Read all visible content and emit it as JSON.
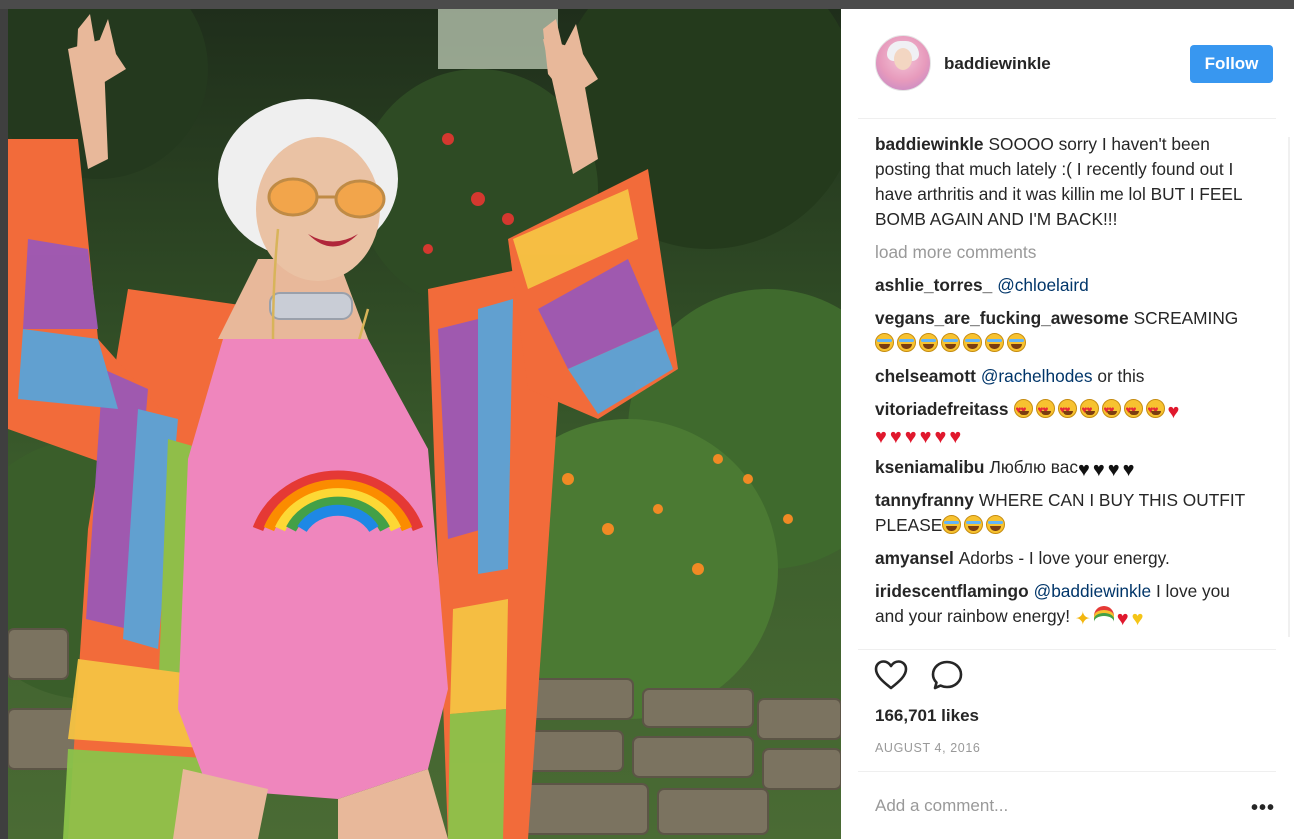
{
  "post": {
    "image_alt": "Woman in rainbow crochet cardigan and pink swimsuit with rainbow print, giving peace signs in a garden",
    "colors": {
      "swimsuit": "#ef86bd",
      "cardigan_orange": "#f26b3a",
      "cardigan_blue": "#5aa3d9",
      "cardigan_purple": "#9b59b6",
      "cardigan_green": "#8bc34a",
      "cardigan_yellow": "#f6c343",
      "foliage": "#2f4a25"
    }
  },
  "header": {
    "username": "baddiewinkle",
    "follow_label": "Follow",
    "follow_color": "#3897f0"
  },
  "caption": {
    "user": "baddiewinkle",
    "text": "SOOOO sorry I haven't been posting that much lately :( I recently found out I have arthritis and it was killin me lol BUT I FEEL BOMB AGAIN AND I'M BACK!!!"
  },
  "load_more": "load more comments",
  "comments": [
    {
      "user": "ashlie_torres_",
      "mention": "@chloelaird",
      "text": ""
    },
    {
      "user": "vegans_are_fucking_awesome",
      "text": "SCREAMING",
      "emojis": [
        "crying-face",
        "crying-face",
        "crying-face",
        "crying-face",
        "crying-face",
        "crying-face",
        "crying-face"
      ]
    },
    {
      "user": "chelseamott",
      "mention": "@rachelhodes",
      "text": "or this"
    },
    {
      "user": "vitoriadefreitass",
      "text": "",
      "emojis": [
        "heart-eyes-face",
        "heart-eyes-face",
        "heart-eyes-face",
        "heart-eyes-face",
        "heart-eyes-face",
        "heart-eyes-face",
        "heart-eyes-face",
        "red-heart",
        "red-heart",
        "red-heart",
        "red-heart",
        "red-heart",
        "red-heart",
        "red-heart"
      ]
    },
    {
      "user": "kseniamalibu",
      "text": "Люблю вас",
      "emojis": [
        "black-heart",
        "black-heart",
        "black-heart",
        "black-heart"
      ]
    },
    {
      "user": "tannyfranny",
      "text": "WHERE CAN I BUY THIS OUTFIT PLEASE",
      "emojis": [
        "crying-face",
        "crying-face",
        "crying-face"
      ]
    },
    {
      "user": "amyansel",
      "text": "Adorbs - I love your energy."
    },
    {
      "user": "iridescentflamingo",
      "mention": "@baddiewinkle",
      "text": "I love you and your rainbow energy!",
      "emojis": [
        "sparkles",
        "rainbow",
        "red-heart",
        "yellow-heart"
      ]
    }
  ],
  "actions": {
    "like_icon": "heart-outline-icon",
    "comment_icon": "speech-bubble-icon",
    "likes": "166,701 likes",
    "date": "AUGUST 4, 2016",
    "add_comment_placeholder": "Add a comment...",
    "more_icon": "ellipsis-icon",
    "more_glyph": "•••"
  }
}
